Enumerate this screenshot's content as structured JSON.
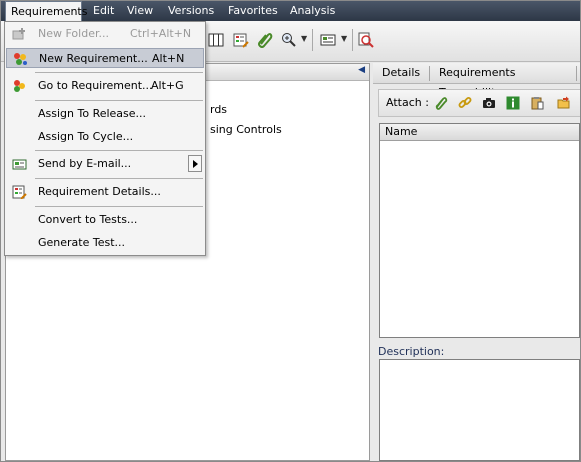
{
  "menubar": {
    "items": [
      "Requirements",
      "Edit",
      "View",
      "Versions",
      "Favorites",
      "Analysis"
    ]
  },
  "dropdown": {
    "items": [
      {
        "label": "New Folder...",
        "shortcut": "Ctrl+Alt+N",
        "icon": "new-folder-icon",
        "enabled": false
      },
      {
        "label": "New Requirement...",
        "shortcut": "Alt+N",
        "icon": "new-requirement-icon",
        "highlighted": true
      },
      {
        "label": "Go to Requirement...",
        "shortcut": "Alt+G",
        "icon": "go-to-requirement-icon"
      },
      {
        "label": "Assign To Release..."
      },
      {
        "label": "Assign To Cycle..."
      },
      {
        "label": "Send by E-mail...",
        "icon": "email-icon",
        "submenu": true
      },
      {
        "label": "Requirement Details...",
        "icon": "requirement-details-icon"
      },
      {
        "label": "Convert to Tests..."
      },
      {
        "label": "Generate Test..."
      }
    ]
  },
  "tree": {
    "partial_items": [
      "rds",
      "sing Controls"
    ]
  },
  "tabs": [
    "Details",
    "Requirements Traceability"
  ],
  "attach": {
    "label": "Attach :",
    "icons": [
      "paperclip-icon",
      "link-icon",
      "camera-icon",
      "info-icon",
      "clipboard-icon",
      "folder-arrow-icon"
    ]
  },
  "grid": {
    "columns": [
      "Name"
    ]
  },
  "description": {
    "label": "Description:"
  }
}
